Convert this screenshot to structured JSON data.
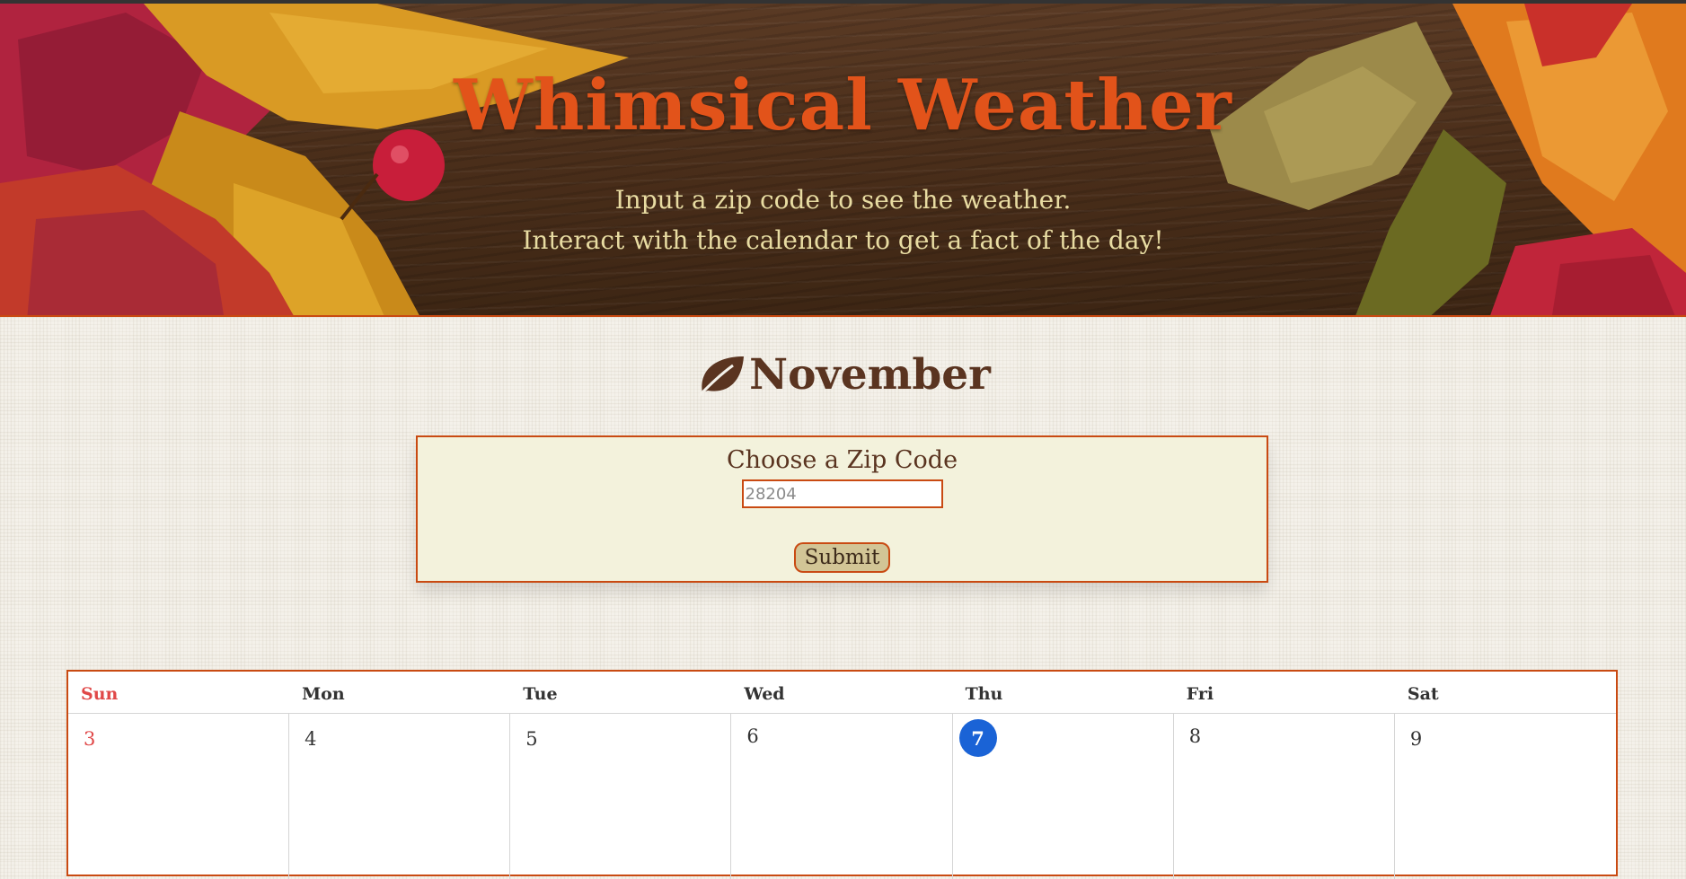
{
  "header": {
    "title": "Whimsical Weather",
    "subtitle_line1": "Input a zip code to see the weather.",
    "subtitle_line2": "Interact with the calendar to get a fact of the day!"
  },
  "month": {
    "icon": "leaf-icon",
    "title": "November"
  },
  "zip_form": {
    "label": "Choose a Zip Code",
    "placeholder": "28204",
    "value": "",
    "submit_label": "Submit"
  },
  "calendar": {
    "weekdays": [
      "Sun",
      "Mon",
      "Tue",
      "Wed",
      "Thu",
      "Fri",
      "Sat"
    ],
    "days": [
      "3",
      "4",
      "5",
      "6",
      "7",
      "8",
      "9"
    ],
    "today": "7"
  },
  "colors": {
    "accent": "#e2531a",
    "border": "#c94a12",
    "today": "#1a63d6",
    "sunday": "#e04848",
    "heading": "#5a3420"
  }
}
